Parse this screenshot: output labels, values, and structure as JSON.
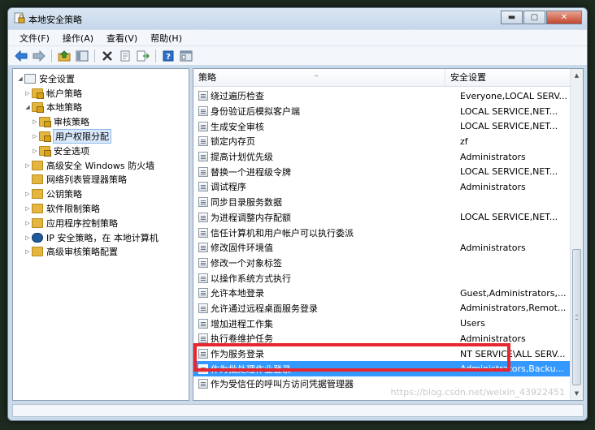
{
  "window": {
    "title": "本地安全策略",
    "caption_minimize": "▬",
    "caption_maximize": "▢",
    "caption_close": "✕"
  },
  "menubar": [
    "文件(F)",
    "操作(A)",
    "查看(V)",
    "帮助(H)"
  ],
  "toolbar": {
    "icons": [
      "back-arrow-icon",
      "forward-arrow-icon",
      "up-folder-icon",
      "show-tree-icon",
      "delete-icon",
      "properties-icon",
      "export-list-icon",
      "help-icon",
      "console-icon"
    ]
  },
  "tree": {
    "items": [
      {
        "label": "安全设置",
        "level": 0,
        "expanded": true
      },
      {
        "label": "帐户策略",
        "level": 1,
        "expanded": false
      },
      {
        "label": "本地策略",
        "level": 1,
        "expanded": true
      },
      {
        "label": "审核策略",
        "level": 2,
        "expanded": false
      },
      {
        "label": "用户权限分配",
        "level": 2,
        "expanded": false,
        "selected": true
      },
      {
        "label": "安全选项",
        "level": 2,
        "expanded": false
      },
      {
        "label": "高级安全 Windows 防火墙",
        "level": 1,
        "expanded": false
      },
      {
        "label": "网络列表管理器策略",
        "level": 1,
        "expanded": null
      },
      {
        "label": "公钥策略",
        "level": 1,
        "expanded": false
      },
      {
        "label": "软件限制策略",
        "level": 1,
        "expanded": false
      },
      {
        "label": "应用程序控制策略",
        "level": 1,
        "expanded": false
      },
      {
        "label": "IP 安全策略，在 本地计算机",
        "level": 1,
        "expanded": false
      },
      {
        "label": "高级审核策略配置",
        "level": 1,
        "expanded": false
      }
    ]
  },
  "list": {
    "columns": [
      "策略",
      "安全设置"
    ],
    "sort_indicator": "^",
    "rows": [
      {
        "policy": "绕过遍历检查",
        "setting": "Everyone,LOCAL SERV..."
      },
      {
        "policy": "身份验证后模拟客户端",
        "setting": "LOCAL SERVICE,NET..."
      },
      {
        "policy": "生成安全审核",
        "setting": "LOCAL SERVICE,NET..."
      },
      {
        "policy": "锁定内存页",
        "setting": "zf"
      },
      {
        "policy": "提高计划优先级",
        "setting": "Administrators"
      },
      {
        "policy": "替换一个进程级令牌",
        "setting": "LOCAL SERVICE,NET..."
      },
      {
        "policy": "调试程序",
        "setting": "Administrators"
      },
      {
        "policy": "同步目录服务数据",
        "setting": ""
      },
      {
        "policy": "为进程调整内存配额",
        "setting": "LOCAL SERVICE,NET..."
      },
      {
        "policy": "信任计算机和用户帐户可以执行委派",
        "setting": ""
      },
      {
        "policy": "修改固件环境值",
        "setting": "Administrators"
      },
      {
        "policy": "修改一个对象标签",
        "setting": ""
      },
      {
        "policy": "以操作系统方式执行",
        "setting": ""
      },
      {
        "policy": "允许本地登录",
        "setting": "Guest,Administrators,..."
      },
      {
        "policy": "允许通过远程桌面服务登录",
        "setting": "Administrators,Remot..."
      },
      {
        "policy": "增加进程工作集",
        "setting": "Users"
      },
      {
        "policy": "执行卷维护任务",
        "setting": "Administrators"
      },
      {
        "policy": "作为服务登录",
        "setting": "NT SERVICE\\ALL SERV..."
      },
      {
        "policy": "作为批处理作业登录",
        "setting": "Administrators,Backu...",
        "selected": true
      },
      {
        "policy": "作为受信任的呼叫方访问凭据管理器",
        "setting": ""
      }
    ]
  },
  "watermark": "https://blog.csdn.net/weixin_43922451",
  "colors": {
    "selection": "#3399ff",
    "highlight_box": "#e8262e"
  }
}
